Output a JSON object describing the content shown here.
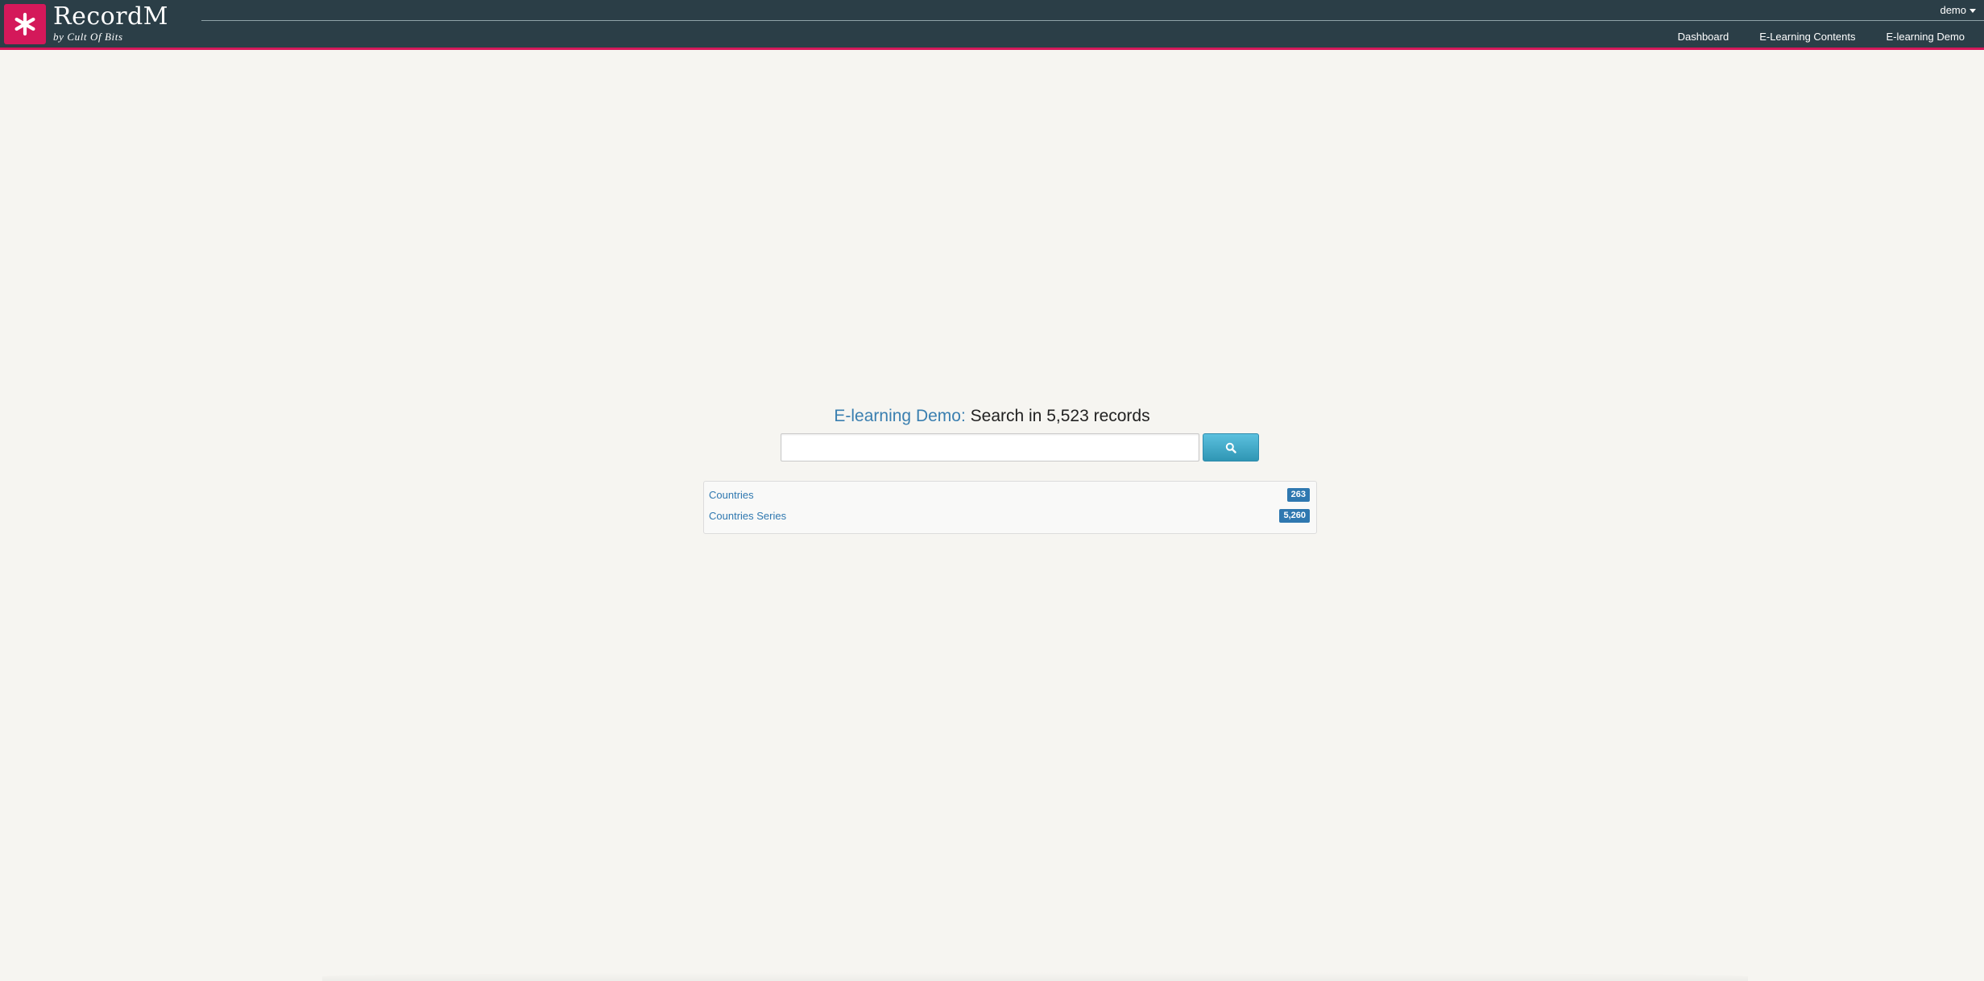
{
  "header": {
    "brand_name": "RecordM",
    "brand_sub": "by Cult Of Bits",
    "logo_icon": "asterisk-icon",
    "user_label": "demo",
    "nav": [
      {
        "label": "Dashboard"
      },
      {
        "label": "E-Learning Contents"
      },
      {
        "label": "E-learning Demo"
      }
    ]
  },
  "search": {
    "app_name": "E-learning Demo:",
    "title_text": "Search in 5,523 records",
    "input_value": "",
    "button_icon": "search-icon"
  },
  "results": [
    {
      "name": "Countries",
      "count": "263"
    },
    {
      "name": "Countries Series",
      "count": "5,260"
    }
  ],
  "colors": {
    "header_bg": "#2b3e47",
    "accent": "#d4185a",
    "link": "#2f78b0",
    "button": "#2f96b4",
    "page_bg": "#f6f5f1"
  }
}
